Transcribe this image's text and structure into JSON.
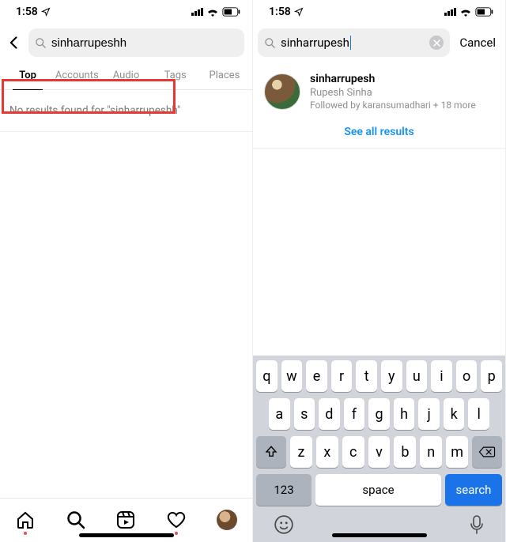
{
  "statusbar": {
    "time": "1:58"
  },
  "left": {
    "search_query": "sinharrupeshh",
    "tabs": [
      "Top",
      "Accounts",
      "Audio",
      "Tags",
      "Places"
    ],
    "active_tab_index": 0,
    "no_results": "No results found for \"sinharrupeshh\""
  },
  "right": {
    "search_query": "sinharrupesh",
    "cancel_label": "Cancel",
    "result": {
      "username": "sinharrupesh",
      "fullname": "Rupesh Sinha",
      "followed_by": "Followed by karansumadhari + 18 more"
    },
    "see_all_label": "See all results",
    "keyboard": {
      "row1": [
        "q",
        "w",
        "e",
        "r",
        "t",
        "y",
        "u",
        "i",
        "o",
        "p"
      ],
      "row2": [
        "a",
        "s",
        "d",
        "f",
        "g",
        "h",
        "j",
        "k",
        "l"
      ],
      "row3": [
        "z",
        "x",
        "c",
        "v",
        "b",
        "n",
        "m"
      ],
      "num_label": "123",
      "space_label": "space",
      "search_label": "search"
    }
  }
}
